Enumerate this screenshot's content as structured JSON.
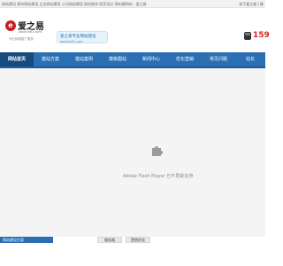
{
  "topbar": {
    "left_text": "网站建设 郑州网站建设 企业网站建设 公司网站建设 网站制作 网页设计 郑州建网站 - 爱之易",
    "right_text": "关于爱之易 | 联"
  },
  "logo": {
    "mark": "e",
    "name": "爱之易",
    "url": "-www.ie61.com-",
    "slogan": "专业网络推广服务"
  },
  "bubble": {
    "title": "爱之易专业网站建设",
    "url": "www.ie61.com"
  },
  "phone": {
    "number": "159"
  },
  "nav": {
    "items": [
      {
        "label": "网站首页"
      },
      {
        "label": "建站方案"
      },
      {
        "label": "建站案例"
      },
      {
        "label": "模板图站"
      },
      {
        "label": "新闻中心"
      },
      {
        "label": "优化营销"
      },
      {
        "label": "常见问题"
      },
      {
        "label": "站长"
      }
    ]
  },
  "flash": {
    "message": "Adobe Flash Player 已不再受支持"
  },
  "bottom": {
    "tab_blue": "网站建设方案",
    "tab_grey_1": "服务器",
    "tab_grey_2": "营销优化"
  },
  "colors": {
    "nav_bg": "#2a6fb3",
    "nav_active": "#174b7f",
    "phone": "#d7261e",
    "logo": "#c61f1f"
  }
}
